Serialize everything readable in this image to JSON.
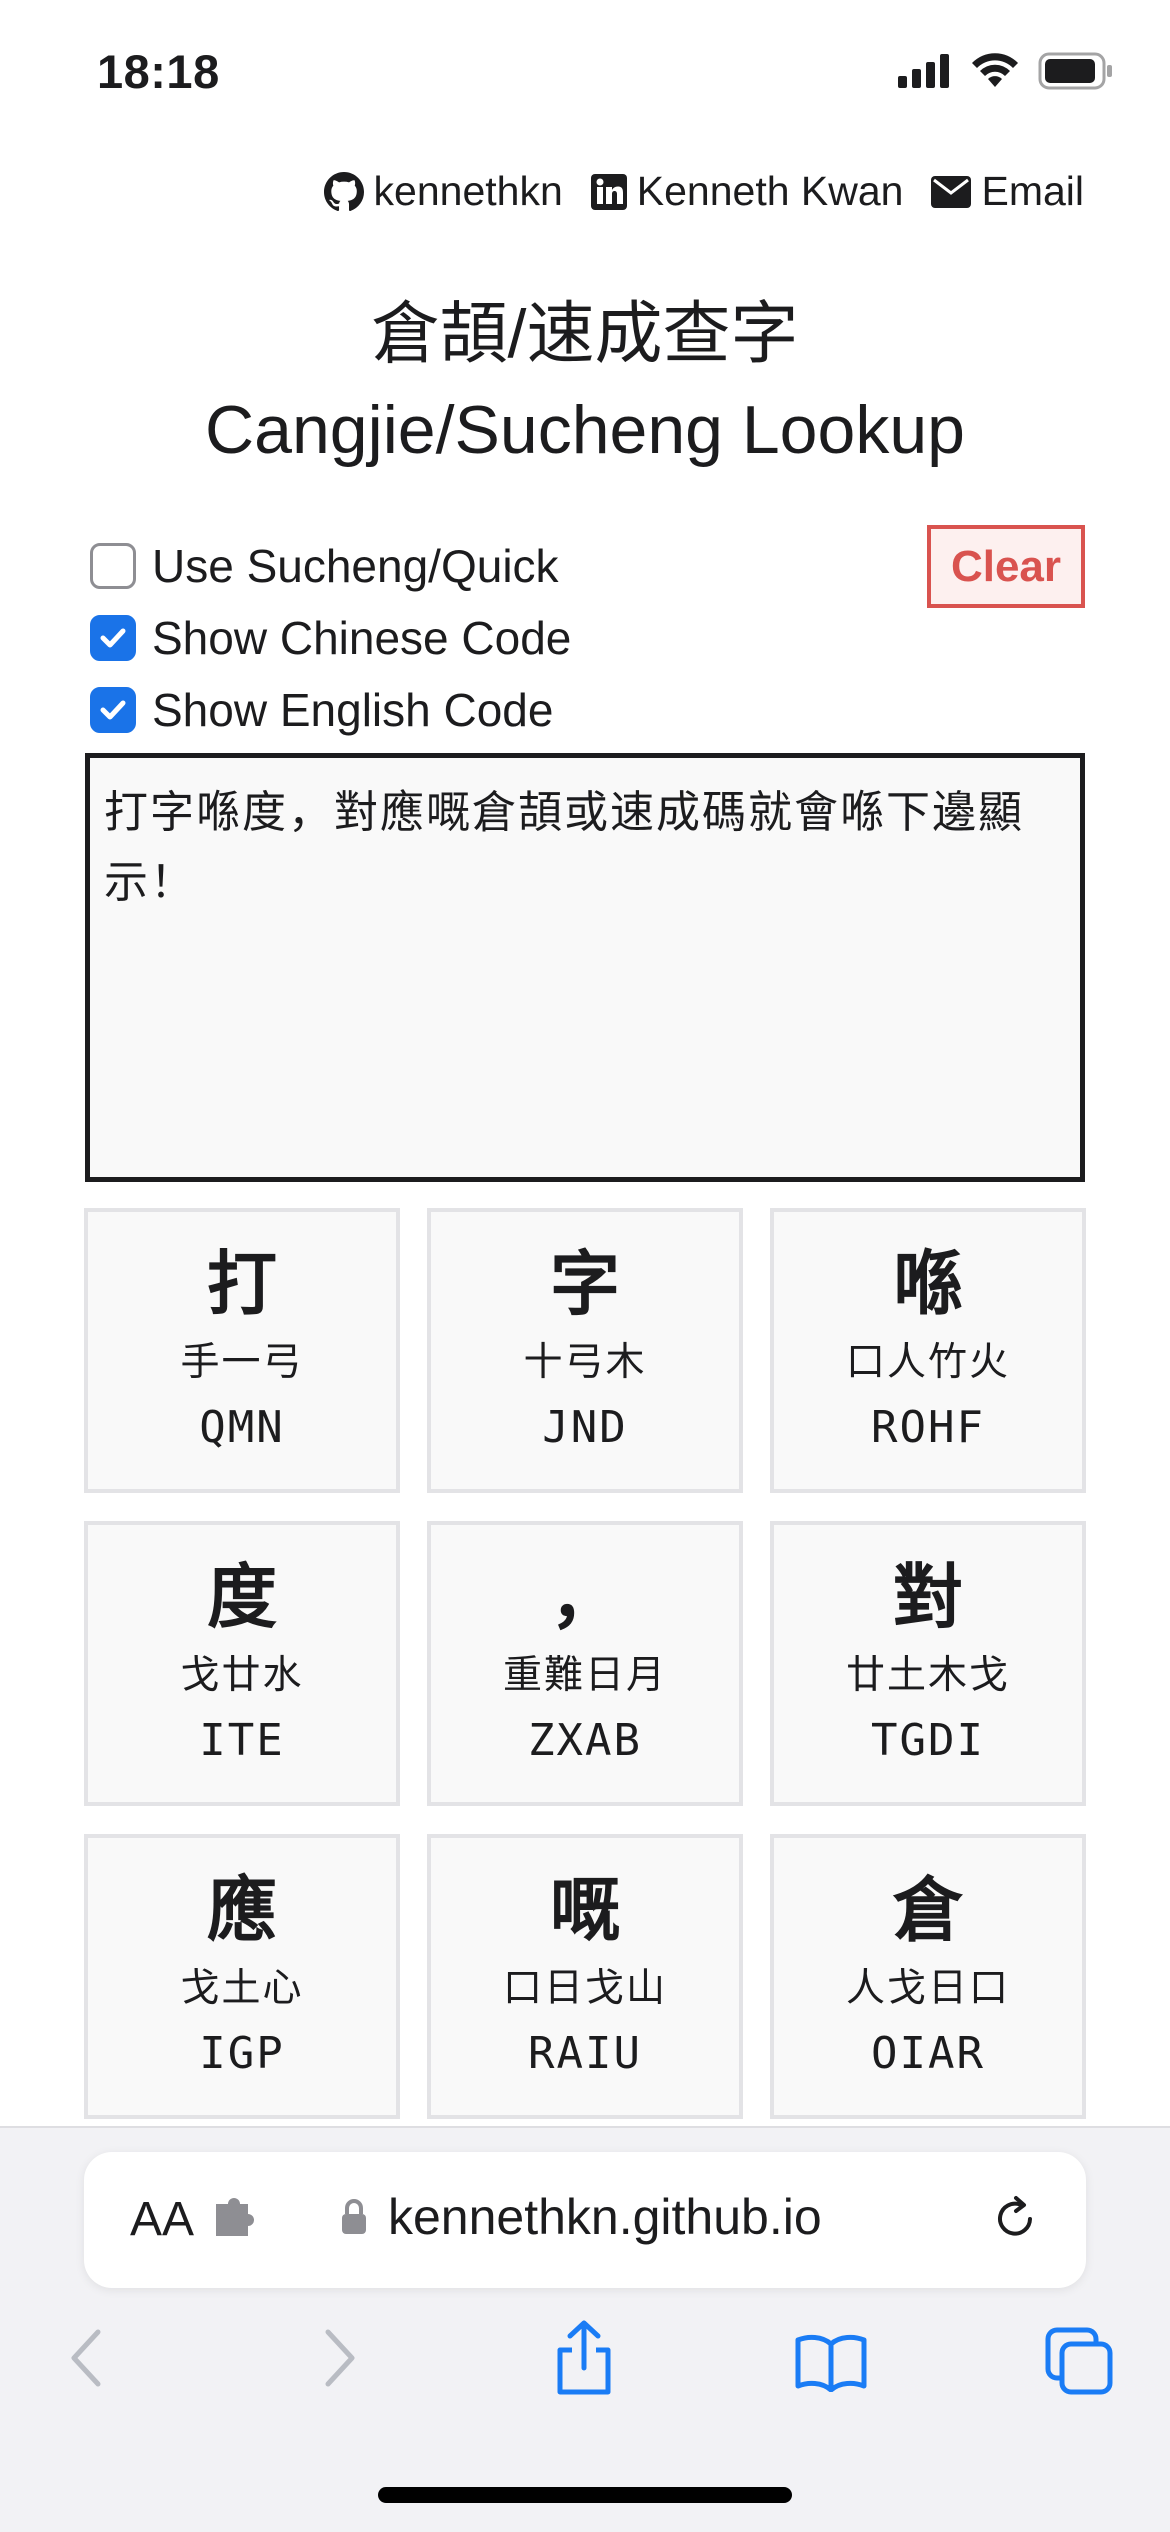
{
  "status_bar": {
    "time": "18:18"
  },
  "header_links": [
    {
      "icon": "github-icon",
      "label": "kennethkn"
    },
    {
      "icon": "linkedin-icon",
      "label": "Kenneth Kwan"
    },
    {
      "icon": "email-icon",
      "label": "Email"
    }
  ],
  "title": {
    "line1": "倉頡/速成查字",
    "line2": "Cangjie/Sucheng Lookup"
  },
  "options": [
    {
      "label": "Use Sucheng/Quick",
      "checked": false
    },
    {
      "label": "Show Chinese Code",
      "checked": true
    },
    {
      "label": "Show English Code",
      "checked": true
    }
  ],
  "clear_label": "Clear",
  "input_text": "打字喺度，對應嘅倉頡或速成碼就會喺下邊顯示！",
  "results": [
    {
      "char": "打",
      "cn": "手一弓",
      "en": "QMN"
    },
    {
      "char": "字",
      "cn": "十弓木",
      "en": "JND"
    },
    {
      "char": "喺",
      "cn": "口人竹火",
      "en": "ROHF"
    },
    {
      "char": "度",
      "cn": "戈廿水",
      "en": "ITE"
    },
    {
      "char": "，",
      "cn": "重難日月",
      "en": "ZXAB"
    },
    {
      "char": "對",
      "cn": "廿土木戈",
      "en": "TGDI"
    },
    {
      "char": "應",
      "cn": "戈土心",
      "en": "IGP"
    },
    {
      "char": "嘅",
      "cn": "口日戈山",
      "en": "RAIU"
    },
    {
      "char": "倉",
      "cn": "人戈日口",
      "en": "OIAR"
    }
  ],
  "browser": {
    "text_size_label": "AA",
    "url": "kennethkn.github.io"
  },
  "colors": {
    "accent": "#1a73e8",
    "danger": "#d9534f",
    "ios_blue": "#1a7cf5"
  }
}
